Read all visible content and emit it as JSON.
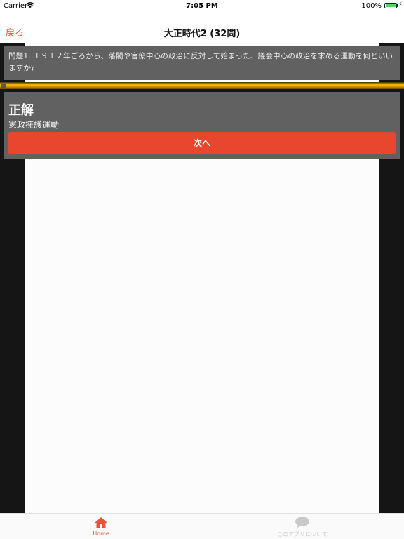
{
  "status_bar": {
    "carrier": "Carrier",
    "time": "7:05 PM",
    "battery": "100%"
  },
  "nav": {
    "back_label": "戻る",
    "title": "大正時代2 (32問)"
  },
  "question": {
    "text": "問題1. １９１２年ごろから、藩閥や官僚中心の政治に反対して始まった、議会中心の政治を求める運動を何といいますか？"
  },
  "answer": {
    "heading": "正解",
    "text": "憲政擁護運動"
  },
  "next_button": "次へ",
  "tabs": [
    {
      "label": "Home",
      "icon": "home-icon",
      "active": true
    },
    {
      "label": "このアプリについて",
      "icon": "speech-bubble-icon",
      "active": false
    }
  ],
  "colors": {
    "accent": "#e8523a",
    "button": "#e8472e",
    "panel": "#616161",
    "gold": "#f0a800"
  }
}
